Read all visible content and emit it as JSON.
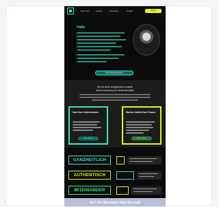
{
  "header": {
    "nav": [
      "Ueber mich",
      "Angebot",
      "Anmeldung",
      "Kontakt"
    ],
    "cta": "Termin"
  },
  "hero": {
    "title": "Hallo",
    "button": "Kennenlerngespraech"
  },
  "section": {
    "heading_1": "Hier ist deine Moeglichkeit zu starten",
    "heading_2": "direkt Anmeldung und Vorabinformation",
    "offers": [
      {
        "title": "Start fuer Unternehmen",
        "button": "Mehr erfahren"
      },
      {
        "title": "Starker Auftritt fuer Frauen",
        "button": "Mehr erfahren"
      }
    ]
  },
  "values": [
    "GANZHEITLICH",
    "AUTHENTISCH",
    "MITEINANDER"
  ],
  "footer": {
    "text": "Ain't No Mountain High Enough"
  },
  "colors": {
    "teal": "#3ee3c8",
    "yellow": "#e3f51d",
    "green": "#34f08a",
    "background": "#0b0b0b",
    "footer": "#b9bdd8"
  }
}
